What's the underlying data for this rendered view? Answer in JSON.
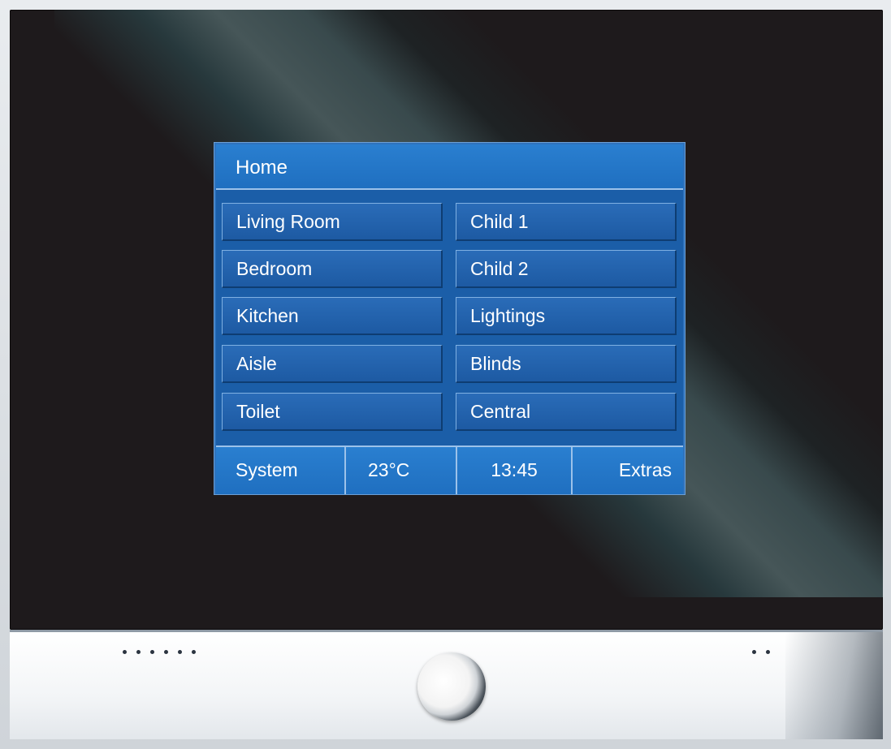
{
  "screen": {
    "title": "Home",
    "rooms_left": [
      "Living Room",
      "Bedroom",
      "Kitchen",
      "Aisle",
      "Toilet"
    ],
    "rooms_right": [
      "Child 1",
      "Child 2",
      "Lightings",
      "Blinds",
      "Central"
    ],
    "footer": {
      "system": "System",
      "temperature": "23°C",
      "time": "13:45",
      "extras": "Extras"
    }
  },
  "colors": {
    "screen_blue": "#1b5ea8",
    "header_blue": "#1f6fc0",
    "bezel": "#1e1a1c",
    "panel": "#f3f5f7"
  },
  "icons": [
    "indicator-dots-left",
    "indicator-dots-right",
    "control-knob"
  ]
}
